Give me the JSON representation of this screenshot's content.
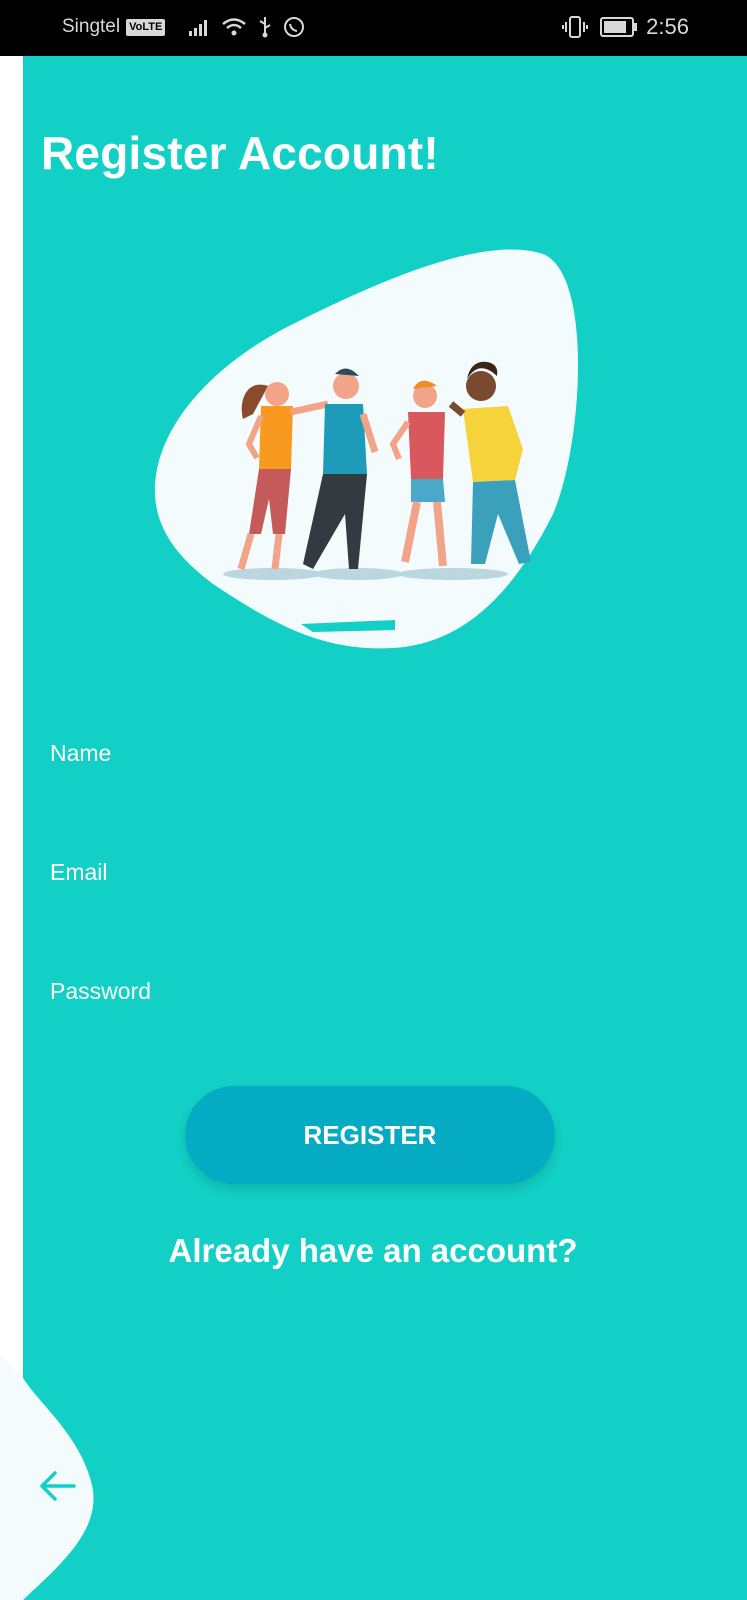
{
  "status_bar": {
    "carrier": "Singtel",
    "network_badge": "VoLTE",
    "time": "2:56",
    "icons": [
      "signal-icon",
      "wifi-icon",
      "usb-icon",
      "whatsapp-icon",
      "vibrate-icon",
      "battery-icon"
    ]
  },
  "page": {
    "title": "Register Account!"
  },
  "form": {
    "name_label": "Name",
    "email_label": "Email",
    "password_label": "Password",
    "register_label": "REGISTER",
    "login_link": "Already have an account?"
  },
  "illustration": {
    "icon": "friends-group-illustration"
  },
  "colors": {
    "background": "#12d0c5",
    "button": "#04abc3",
    "text": "#ffffff",
    "blob": "#f4fbfd"
  }
}
